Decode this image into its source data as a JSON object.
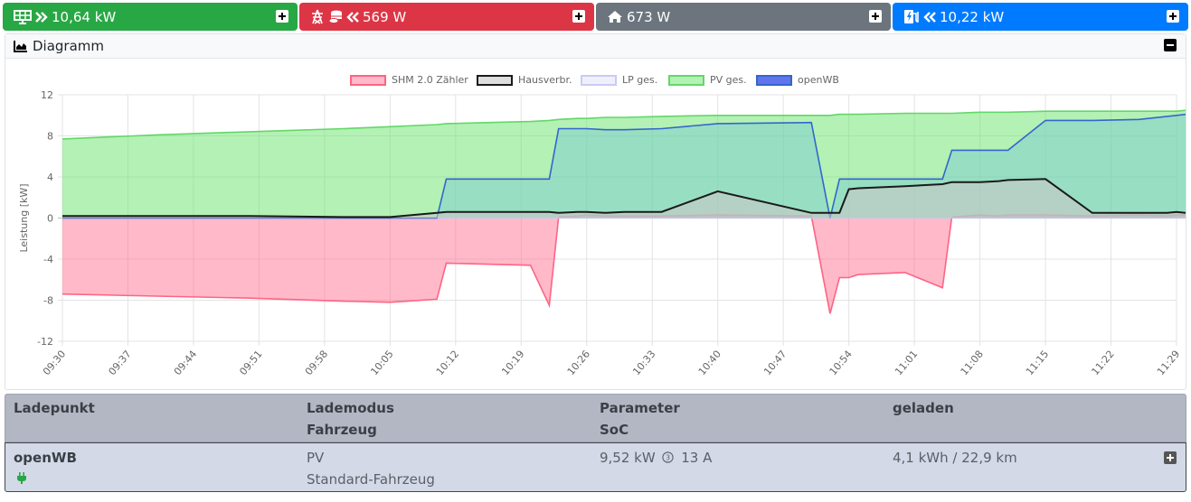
{
  "tiles": {
    "pv": {
      "value": "10,64 kW",
      "color": "#28a745",
      "icons": [
        "solar-panel-icon",
        "double-chevron-right-icon"
      ]
    },
    "grid": {
      "value": "569 W",
      "color": "#dc3545",
      "icons": [
        "power-tower-icon",
        "coins-icon",
        "double-chevron-left-icon"
      ]
    },
    "house": {
      "value": "673 W",
      "color": "#6c757d",
      "icons": [
        "home-icon"
      ]
    },
    "charge": {
      "value": "10,22 kW",
      "color": "#007bff",
      "icons": [
        "charging-station-icon",
        "double-chevron-left-icon"
      ]
    }
  },
  "diagram": {
    "title": "Diagramm",
    "icon": "area-chart-icon"
  },
  "chart_data": {
    "type": "area",
    "ylabel": "Leistung [kW]",
    "ylim": [
      -12,
      12
    ],
    "yticks": [
      12,
      8,
      4,
      0,
      -4,
      -8,
      -12
    ],
    "xticks": [
      "09:30",
      "09:37",
      "09:44",
      "09:51",
      "09:58",
      "10:05",
      "10:12",
      "10:19",
      "10:26",
      "10:33",
      "10:40",
      "10:47",
      "10:54",
      "11:01",
      "11:08",
      "11:15",
      "11:22",
      "11:29"
    ],
    "grid": true,
    "legend_position": "top-center",
    "x_minutes": [
      0,
      10,
      20,
      30,
      35,
      40,
      41,
      50,
      52,
      53,
      55,
      56,
      58,
      60,
      64,
      70,
      80,
      82,
      83,
      84,
      85,
      90,
      94,
      95,
      98,
      100,
      101,
      105,
      110,
      115,
      118,
      119,
      120,
      125,
      129,
      130
    ],
    "series": [
      {
        "name": "SHM 2.0 Zähler",
        "color": "#ff6384",
        "fill": "rgba(255,99,132,0.45)",
        "values": [
          -7.4,
          -7.6,
          -7.8,
          -8.1,
          -8.2,
          -7.9,
          -4.4,
          -4.6,
          -8.5,
          0.1,
          0.2,
          0.3,
          0.2,
          0.2,
          0.2,
          0.3,
          0.2,
          -9.3,
          -5.8,
          -5.8,
          -5.5,
          -5.3,
          -6.8,
          0.1,
          0.3,
          0.2,
          0.3,
          0.3,
          0.2,
          0.3,
          0.2,
          0.3,
          0.3,
          0.2,
          0.3,
          0.3
        ]
      },
      {
        "name": "Hausverbr.",
        "color": "#1a1a1a",
        "fill": "rgba(200,200,200,0.6)",
        "values": [
          0.2,
          0.2,
          0.2,
          0.1,
          0.1,
          0.5,
          0.6,
          0.6,
          0.6,
          0.5,
          0.6,
          0.6,
          0.5,
          0.6,
          0.6,
          2.6,
          0.5,
          0.5,
          0.5,
          2.8,
          2.9,
          3.1,
          3.3,
          3.5,
          3.5,
          3.6,
          3.7,
          3.8,
          0.5,
          0.5,
          0.5,
          0.6,
          0.5,
          0.6,
          0.6,
          0.5
        ]
      },
      {
        "name": "LP ges.",
        "color": "#c9cbf5",
        "fill": "rgba(230,230,250,0.6)",
        "values": [
          0,
          0,
          0,
          0,
          0,
          0,
          0,
          0,
          0,
          0,
          0,
          0,
          0,
          0,
          0,
          0,
          0,
          0,
          0,
          0,
          0,
          0,
          0,
          0,
          0,
          0,
          0,
          0,
          0,
          0,
          0,
          0,
          0,
          0,
          0,
          0
        ]
      },
      {
        "name": "PV ges.",
        "color": "#62d867",
        "fill": "rgba(104,228,108,0.5)",
        "values": [
          7.7,
          8.1,
          8.4,
          8.7,
          8.9,
          9.1,
          9.2,
          9.4,
          9.5,
          9.6,
          9.7,
          9.7,
          9.8,
          9.8,
          9.9,
          10.0,
          10.0,
          10.0,
          10.1,
          10.1,
          10.1,
          10.2,
          10.2,
          10.2,
          10.3,
          10.3,
          10.3,
          10.4,
          10.4,
          10.4,
          10.4,
          10.4,
          10.5,
          10.5,
          10.6,
          10.6
        ]
      },
      {
        "name": "openWB",
        "color": "#3366cc",
        "fill": "rgba(70,90,235,0.85)",
        "values": [
          0,
          0,
          0,
          0,
          0,
          0,
          3.8,
          3.8,
          3.8,
          8.7,
          8.7,
          8.7,
          8.6,
          8.6,
          8.7,
          9.2,
          9.3,
          0,
          3.8,
          3.8,
          3.8,
          3.8,
          3.8,
          6.6,
          6.6,
          6.6,
          6.6,
          9.5,
          9.5,
          9.6,
          9.9,
          10.0,
          10.1,
          10.2,
          10.3,
          10.3
        ]
      }
    ]
  },
  "table": {
    "headers": {
      "col1": [
        "Ladepunkt"
      ],
      "col2": [
        "Lademodus",
        "Fahrzeug"
      ],
      "col3": [
        "Parameter",
        "SoC"
      ],
      "col4": [
        "geladen"
      ]
    },
    "row": {
      "name": "openWB",
      "plug_icon": "plug-icon",
      "mode": "PV",
      "vehicle": "Standard-Fahrzeug",
      "power": "9,52 kW",
      "phases_icon": "phase-icon",
      "phases": "3",
      "current": "13 A",
      "charged": "4,1 kWh / 22,9 km"
    }
  }
}
